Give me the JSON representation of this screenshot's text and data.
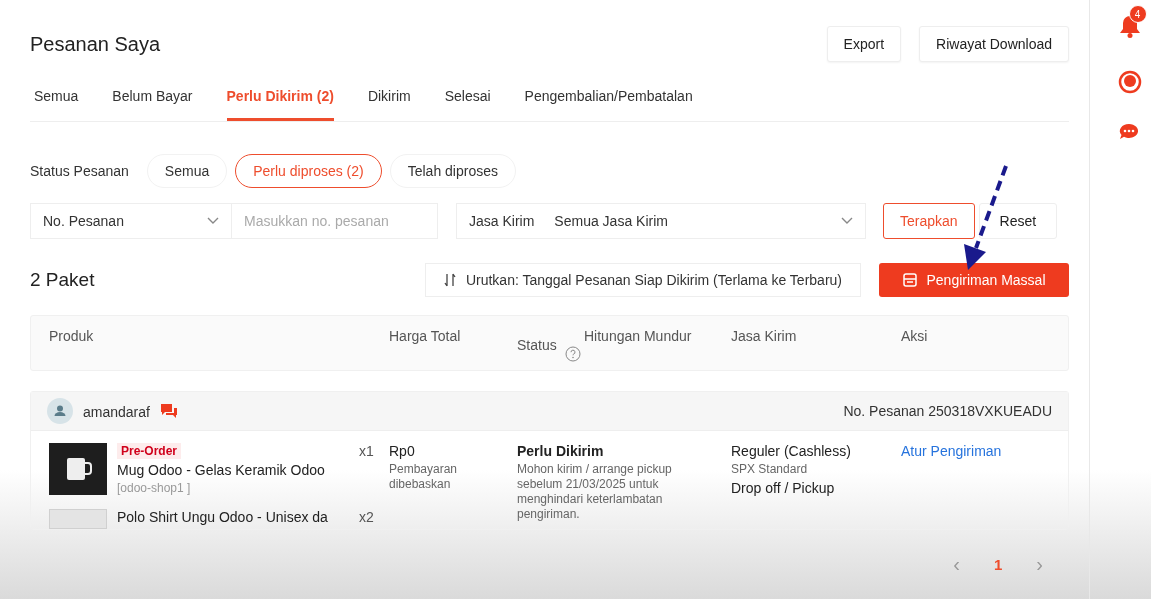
{
  "header": {
    "title": "Pesanan Saya",
    "buttons": [
      "Export",
      "Riwayat Download"
    ]
  },
  "tabs": [
    {
      "label": "Semua",
      "selected": false
    },
    {
      "label": "Belum Bayar",
      "selected": false
    },
    {
      "label": "Perlu Dikirim (2)",
      "selected": true
    },
    {
      "label": "Dikirim",
      "selected": false
    },
    {
      "label": "Selesai",
      "selected": false
    },
    {
      "label": "Pengembalian/Pembatalan",
      "selected": false
    }
  ],
  "status_filter": {
    "label": "Status Pesanan",
    "options": [
      {
        "label": "Semua",
        "selected": false
      },
      {
        "label": "Perlu diproses (2)",
        "selected": true
      },
      {
        "label": "Telah diproses",
        "selected": false
      }
    ]
  },
  "search": {
    "field": "No. Pesanan",
    "placeholder": "Masukkan no. pesanan"
  },
  "courier_filter": {
    "label": "Jasa Kirim",
    "value": "Semua Jasa Kirim"
  },
  "filter_buttons": [
    {
      "label": "Terapkan",
      "kind": "outline"
    },
    {
      "label": "Reset",
      "kind": "plain"
    }
  ],
  "package_count": "2 Paket",
  "sort": "Urutkan: Tanggal Pesanan Siap Dikirim (Terlama ke Terbaru)",
  "bulk_button": "Pengiriman Massal",
  "table": {
    "columns": [
      {
        "label": "Produk"
      },
      {
        "label": "Harga Total"
      },
      {
        "label": "Status",
        "help": true
      },
      {
        "label": "Hitungan Mundur"
      },
      {
        "label": "Jasa Kirim"
      },
      {
        "label": "Aksi"
      }
    ]
  },
  "orders": [
    {
      "buyer": "amandaraf",
      "order_no": "No. Pesanan 250318VXKUEADU",
      "items": [
        {
          "tag": "Pre-Order",
          "name": "Mug Odoo - Gelas Keramik Odoo",
          "sku": "[odoo-shop1 ]",
          "qty": "x1"
        },
        {
          "name": "Polo Shirt Ungu Odoo - Unisex da",
          "qty": "x2"
        }
      ],
      "price": "Rp0",
      "payment_note": "Pembayaran dibebaskan",
      "status": "Perlu Dikirim",
      "status_note": "Mohon kirim / arrange pickup sebelum 21/03/2025 untuk menghindari keterlambatan pengiriman.",
      "shipping": "Reguler (Cashless)",
      "courier": "SPX Standard",
      "method": "Drop off / Pickup",
      "action": "Atur Pengiriman"
    }
  ],
  "pagination": {
    "prev": "‹",
    "next": "›",
    "pages": [
      {
        "label": "1",
        "selected": true
      }
    ]
  },
  "sidebar": {
    "notification_count": "4"
  }
}
